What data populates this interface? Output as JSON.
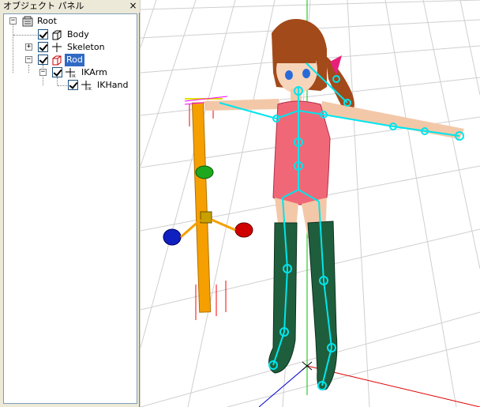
{
  "panel": {
    "title": "オブジェクト パネル",
    "close_label": "×"
  },
  "tree": {
    "root": "Root",
    "body": "Body",
    "skeleton": "Skeleton",
    "rod": "Rod",
    "ikarm": "IKArm",
    "ikhand": "IKHand"
  },
  "colors": {
    "selection": "#316ac5",
    "rod_icon": "#cc0000",
    "bones": "#00e5ee",
    "rod": "#f5a000",
    "axis_x": "#e00000",
    "axis_y": "#00c000",
    "axis_z": "#0000d0"
  }
}
